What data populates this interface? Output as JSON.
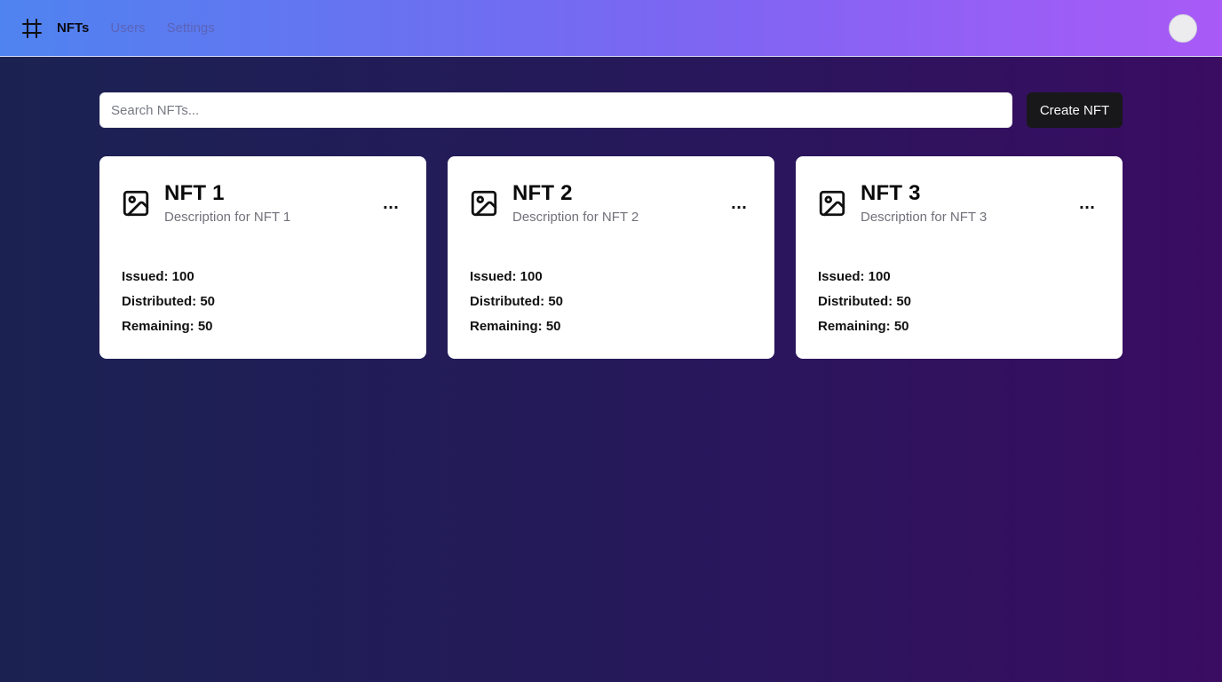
{
  "header": {
    "logo_icon": "hash-icon",
    "nav": [
      {
        "label": "NFTs",
        "active": true
      },
      {
        "label": "Users",
        "active": false
      },
      {
        "label": "Settings",
        "active": false
      }
    ]
  },
  "toolbar": {
    "search_placeholder": "Search NFTs...",
    "create_label": "Create NFT"
  },
  "cards": [
    {
      "title": "NFT 1",
      "description": "Description for NFT 1",
      "issued": "Issued: 100",
      "distributed": "Distributed: 50",
      "remaining": "Remaining: 50",
      "menu": "..."
    },
    {
      "title": "NFT 2",
      "description": "Description for NFT 2",
      "issued": "Issued: 100",
      "distributed": "Distributed: 50",
      "remaining": "Remaining: 50",
      "menu": "..."
    },
    {
      "title": "NFT 3",
      "description": "Description for NFT 3",
      "issued": "Issued: 100",
      "distributed": "Distributed: 50",
      "remaining": "Remaining: 50",
      "menu": "..."
    }
  ],
  "colors": {
    "header_start": "#4f83f0",
    "header_end": "#a95af7",
    "bg_start": "#1b2252",
    "bg_end": "#3a0c62",
    "button": "#18181b"
  }
}
